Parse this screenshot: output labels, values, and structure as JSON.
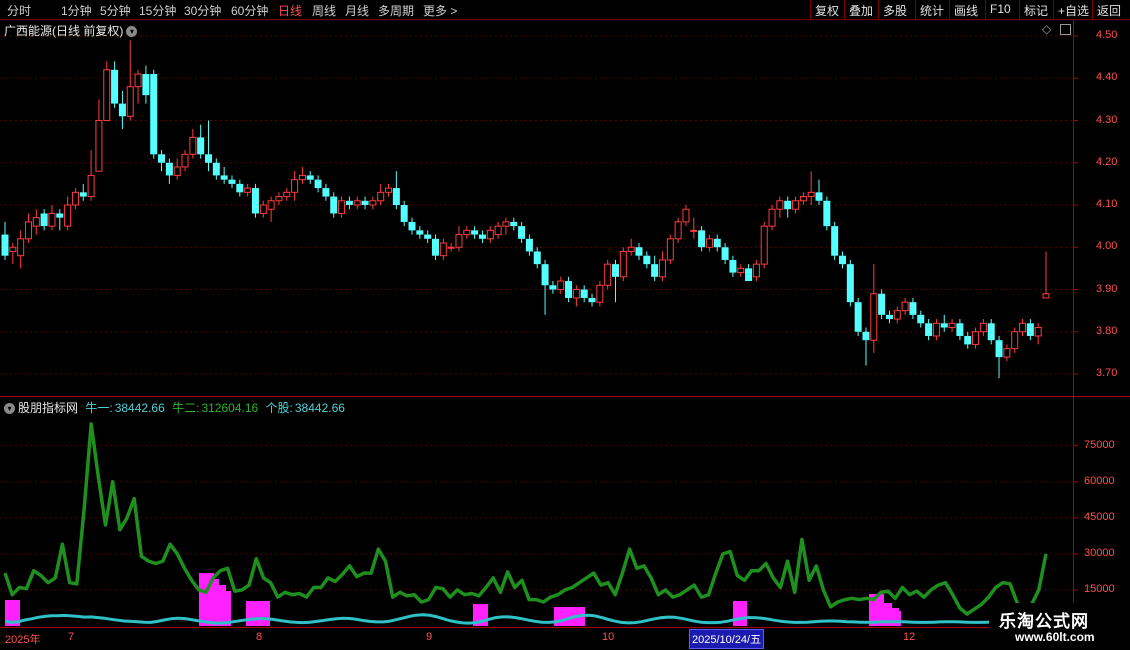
{
  "toolbar": {
    "periods": [
      "分时",
      "1分钟",
      "5分钟",
      "15分钟",
      "30分钟",
      "60分钟",
      "日线",
      "周线",
      "月线",
      "多周期",
      "更多"
    ],
    "active_period": "日线",
    "more_arrow": ">",
    "buttons": [
      "复权",
      "叠加",
      "多股",
      "统计",
      "画线",
      "F10",
      "标记",
      "+自选",
      "返回"
    ]
  },
  "main_panel": {
    "title": "广西能源(日线 前复权)",
    "price_ticks": [
      "4.50",
      "4.40",
      "4.30",
      "4.20",
      "4.10",
      "4.00",
      "3.90",
      "3.80",
      "3.70"
    ],
    "price_range": [
      3.665,
      4.535
    ]
  },
  "indicator_panel": {
    "name": "股朋指标网",
    "legend": [
      {
        "label": "牛一:",
        "value": "38442.66",
        "color": "#4fd2d9"
      },
      {
        "label": "牛二:",
        "value": "312604.16",
        "color": "#2fb52f"
      },
      {
        "label": "个股:",
        "value": "38442.66",
        "color": "#4fd2d9"
      }
    ],
    "ticks": [
      "75000",
      "60000",
      "45000",
      "30000",
      "15000"
    ],
    "range": [
      0,
      89000
    ]
  },
  "date_axis": {
    "labels": [
      "2025年",
      "7",
      "8",
      "9",
      "10",
      "12"
    ],
    "selected_date": "2025/10/24/五"
  },
  "colors": {
    "up": "#ff3c3c",
    "down": "#54ffff",
    "green_line": "#1f8f1f",
    "cyan_line": "#2fc0c8",
    "magenta": "#ff22ff",
    "grid": "#5a0000",
    "axis": "#ff5050"
  },
  "chart_data": {
    "type": "candlestick",
    "candles": [
      [
        4.03,
        3.98,
        4.06,
        3.97
      ],
      [
        3.99,
        4.0,
        4.01,
        3.96
      ],
      [
        3.98,
        4.02,
        4.04,
        3.95
      ],
      [
        4.02,
        4.06,
        4.08,
        4.01
      ],
      [
        4.05,
        4.07,
        4.09,
        4.03
      ],
      [
        4.08,
        4.05,
        4.09,
        4.04
      ],
      [
        4.05,
        4.08,
        4.1,
        4.04
      ],
      [
        4.08,
        4.07,
        4.09,
        4.04
      ],
      [
        4.05,
        4.1,
        4.12,
        4.04
      ],
      [
        4.1,
        4.13,
        4.14,
        4.09
      ],
      [
        4.13,
        4.12,
        4.15,
        4.11
      ],
      [
        4.12,
        4.17,
        4.23,
        4.11
      ],
      [
        4.18,
        4.3,
        4.35,
        4.29
      ],
      [
        4.3,
        4.42,
        4.44,
        4.3
      ],
      [
        4.42,
        4.34,
        4.44,
        4.33
      ],
      [
        4.34,
        4.31,
        4.37,
        4.28
      ],
      [
        4.31,
        4.38,
        4.49,
        4.3
      ],
      [
        4.38,
        4.41,
        4.42,
        4.34
      ],
      [
        4.41,
        4.36,
        4.43,
        4.34
      ],
      [
        4.41,
        4.22,
        4.42,
        4.21
      ],
      [
        4.22,
        4.2,
        4.23,
        4.18
      ],
      [
        4.2,
        4.17,
        4.21,
        4.15
      ],
      [
        4.17,
        4.19,
        4.21,
        4.16
      ],
      [
        4.19,
        4.22,
        4.23,
        4.18
      ],
      [
        4.22,
        4.26,
        4.28,
        4.21
      ],
      [
        4.26,
        4.22,
        4.29,
        4.21
      ],
      [
        4.22,
        4.2,
        4.3,
        4.18
      ],
      [
        4.2,
        4.17,
        4.21,
        4.16
      ],
      [
        4.17,
        4.16,
        4.19,
        4.15
      ],
      [
        4.16,
        4.15,
        4.17,
        4.14
      ],
      [
        4.15,
        4.13,
        4.16,
        4.12
      ],
      [
        4.13,
        4.14,
        4.15,
        4.12
      ],
      [
        4.14,
        4.08,
        4.15,
        4.07
      ],
      [
        4.08,
        4.1,
        4.11,
        4.07
      ],
      [
        4.09,
        4.11,
        4.12,
        4.06
      ],
      [
        4.11,
        4.12,
        4.13,
        4.1
      ],
      [
        4.12,
        4.13,
        4.14,
        4.11
      ],
      [
        4.13,
        4.16,
        4.18,
        4.11
      ],
      [
        4.16,
        4.17,
        4.19,
        4.15
      ],
      [
        4.17,
        4.16,
        4.18,
        4.15
      ],
      [
        4.16,
        4.14,
        4.17,
        4.13
      ],
      [
        4.14,
        4.12,
        4.15,
        4.11
      ],
      [
        4.12,
        4.08,
        4.13,
        4.07
      ],
      [
        4.08,
        4.11,
        4.12,
        4.07
      ],
      [
        4.11,
        4.1,
        4.12,
        4.09
      ],
      [
        4.1,
        4.11,
        4.12,
        4.09
      ],
      [
        4.11,
        4.1,
        4.12,
        4.09
      ],
      [
        4.1,
        4.11,
        4.12,
        4.09
      ],
      [
        4.11,
        4.13,
        4.15,
        4.1
      ],
      [
        4.13,
        4.14,
        4.15,
        4.12
      ],
      [
        4.14,
        4.1,
        4.18,
        4.09
      ],
      [
        4.1,
        4.06,
        4.11,
        4.05
      ],
      [
        4.06,
        4.04,
        4.07,
        4.03
      ],
      [
        4.04,
        4.03,
        4.05,
        4.02
      ],
      [
        4.03,
        4.02,
        4.04,
        4.01
      ],
      [
        4.02,
        3.98,
        4.03,
        3.97
      ],
      [
        3.98,
        4.01,
        4.02,
        3.97
      ],
      [
        4.0,
        4.0,
        4.01,
        3.99
      ],
      [
        4.0,
        4.03,
        4.05,
        3.99
      ],
      [
        4.03,
        4.04,
        4.05,
        4.02
      ],
      [
        4.04,
        4.03,
        4.05,
        4.02
      ],
      [
        4.03,
        4.02,
        4.04,
        4.01
      ],
      [
        4.02,
        4.04,
        4.05,
        4.01
      ],
      [
        4.03,
        4.05,
        4.06,
        4.02
      ],
      [
        4.05,
        4.06,
        4.07,
        4.03
      ],
      [
        4.06,
        4.05,
        4.07,
        4.04
      ],
      [
        4.05,
        4.02,
        4.06,
        4.01
      ],
      [
        4.02,
        3.99,
        4.03,
        3.98
      ],
      [
        3.99,
        3.96,
        4.0,
        3.95
      ],
      [
        3.96,
        3.91,
        3.97,
        3.84
      ],
      [
        3.91,
        3.9,
        3.92,
        3.89
      ],
      [
        3.9,
        3.92,
        3.93,
        3.89
      ],
      [
        3.92,
        3.88,
        3.93,
        3.87
      ],
      [
        3.88,
        3.9,
        3.91,
        3.86
      ],
      [
        3.9,
        3.88,
        3.91,
        3.87
      ],
      [
        3.88,
        3.87,
        3.89,
        3.86
      ],
      [
        3.87,
        3.91,
        3.92,
        3.86
      ],
      [
        3.91,
        3.96,
        3.97,
        3.9
      ],
      [
        3.96,
        3.93,
        3.97,
        3.87
      ],
      [
        3.93,
        3.99,
        4.0,
        3.92
      ],
      [
        3.99,
        4.0,
        4.02,
        3.98
      ],
      [
        4.0,
        3.98,
        4.01,
        3.97
      ],
      [
        3.98,
        3.96,
        3.99,
        3.95
      ],
      [
        3.96,
        3.93,
        3.98,
        3.92
      ],
      [
        3.93,
        3.97,
        3.99,
        3.92
      ],
      [
        3.97,
        4.02,
        4.03,
        3.96
      ],
      [
        4.02,
        4.06,
        4.07,
        4.01
      ],
      [
        4.06,
        4.09,
        4.1,
        4.05
      ],
      [
        4.04,
        4.04,
        4.07,
        4.02
      ],
      [
        4.04,
        4.0,
        4.05,
        3.99
      ],
      [
        4.0,
        4.02,
        4.03,
        3.99
      ],
      [
        4.02,
        4.0,
        4.03,
        3.99
      ],
      [
        4.0,
        3.97,
        4.01,
        3.96
      ],
      [
        3.97,
        3.94,
        3.98,
        3.93
      ],
      [
        3.94,
        3.95,
        3.96,
        3.93
      ],
      [
        3.95,
        3.92,
        3.96,
        3.93
      ],
      [
        3.93,
        3.96,
        3.97,
        3.92
      ],
      [
        3.96,
        4.05,
        4.06,
        3.95
      ],
      [
        4.05,
        4.09,
        4.1,
        4.04
      ],
      [
        4.09,
        4.11,
        4.12,
        4.07
      ],
      [
        4.11,
        4.09,
        4.12,
        4.07
      ],
      [
        4.09,
        4.11,
        4.12,
        4.08
      ],
      [
        4.11,
        4.12,
        4.13,
        4.1
      ],
      [
        4.12,
        4.13,
        4.18,
        4.1
      ],
      [
        4.13,
        4.11,
        4.16,
        4.1
      ],
      [
        4.11,
        4.05,
        4.12,
        4.04
      ],
      [
        4.05,
        3.98,
        4.06,
        3.97
      ],
      [
        3.98,
        3.96,
        3.99,
        3.95
      ],
      [
        3.96,
        3.87,
        3.97,
        3.86
      ],
      [
        3.87,
        3.8,
        3.88,
        3.79
      ],
      [
        3.8,
        3.78,
        3.81,
        3.72
      ],
      [
        3.78,
        3.89,
        3.96,
        3.75
      ],
      [
        3.89,
        3.84,
        3.9,
        3.83
      ],
      [
        3.84,
        3.83,
        3.85,
        3.82
      ],
      [
        3.83,
        3.85,
        3.86,
        3.82
      ],
      [
        3.85,
        3.87,
        3.88,
        3.84
      ],
      [
        3.87,
        3.84,
        3.88,
        3.83
      ],
      [
        3.84,
        3.82,
        3.85,
        3.81
      ],
      [
        3.82,
        3.79,
        3.83,
        3.78
      ],
      [
        3.79,
        3.82,
        3.83,
        3.78
      ],
      [
        3.82,
        3.81,
        3.84,
        3.8
      ],
      [
        3.81,
        3.82,
        3.83,
        3.8
      ],
      [
        3.82,
        3.79,
        3.83,
        3.78
      ],
      [
        3.79,
        3.77,
        3.8,
        3.76
      ],
      [
        3.77,
        3.8,
        3.81,
        3.76
      ],
      [
        3.8,
        3.82,
        3.83,
        3.79
      ],
      [
        3.82,
        3.78,
        3.83,
        3.77
      ],
      [
        3.78,
        3.74,
        3.79,
        3.69
      ],
      [
        3.74,
        3.76,
        3.77,
        3.73
      ],
      [
        3.76,
        3.8,
        3.81,
        3.75
      ],
      [
        3.8,
        3.82,
        3.83,
        3.79
      ],
      [
        3.82,
        3.79,
        3.83,
        3.78
      ],
      [
        3.79,
        3.81,
        3.82,
        3.77
      ],
      [
        3.88,
        3.89,
        3.99,
        3.88
      ]
    ],
    "green_line": [
      22000,
      13000,
      16000,
      15500,
      23000,
      21000,
      18000,
      20000,
      34000,
      18000,
      17500,
      48000,
      84000,
      62000,
      42000,
      60000,
      40000,
      45000,
      53000,
      29000,
      27000,
      26000,
      27000,
      34000,
      30000,
      24000,
      19000,
      15000,
      14000,
      20000,
      23000,
      24000,
      14500,
      15000,
      17000,
      28000,
      20000,
      18000,
      12000,
      14000,
      13000,
      13500,
      12000,
      16000,
      16000,
      20000,
      18500,
      21500,
      25000,
      20500,
      22000,
      22000,
      32000,
      27000,
      12000,
      14000,
      12500,
      13000,
      10000,
      11000,
      16000,
      15500,
      12000,
      15000,
      13000,
      13500,
      12500,
      16000,
      20000,
      14000,
      22500,
      16000,
      19000,
      11000,
      11000,
      10000,
      12000,
      13000,
      15000,
      16000,
      18000,
      20000,
      22000,
      17000,
      18000,
      13000,
      22000,
      32000,
      24000,
      25000,
      20000,
      13000,
      15000,
      12000,
      13000,
      15000,
      17000,
      12000,
      13000,
      22000,
      30000,
      31000,
      21000,
      19000,
      23000,
      23000,
      26000,
      20000,
      16000,
      27000,
      14000,
      36000,
      19000,
      25000,
      15000,
      8000,
      10000,
      11000,
      11500,
      11000,
      11500,
      11000,
      14000,
      14500,
      11500,
      16000,
      13000,
      14500,
      12000,
      15000,
      17000,
      18000,
      13000,
      7500,
      5000,
      7000,
      9000,
      12000,
      16000,
      18000,
      17500,
      9500,
      7000,
      9000,
      15000,
      30000
    ],
    "cyan_line": [
      2000,
      1500,
      1800,
      2500,
      3000,
      3600,
      4000,
      4300,
      4300,
      4400,
      4200,
      4000,
      3700,
      3800,
      3500,
      3200,
      2800,
      2400,
      2100,
      1900,
      1800,
      1600,
      1500,
      1900,
      2500,
      3000,
      3200,
      3100,
      2700,
      2200,
      1800,
      1400,
      1200,
      1300,
      1600,
      2000,
      2400,
      2800,
      3000,
      3100,
      2900,
      2500,
      2100,
      1700,
      1500,
      1400,
      1600,
      1900,
      2300,
      2700,
      3000,
      3200,
      3100,
      2800,
      2300,
      1900,
      1700,
      1700,
      2000,
      2600,
      3300,
      4000,
      4500,
      4700,
      4500,
      3900,
      3100,
      2300,
      1700,
      1300,
      1200,
      1400,
      2000,
      2800,
      3500,
      3800,
      3800,
      3500,
      3000,
      2400,
      1900,
      1600,
      1500,
      1700,
      2300,
      3100,
      3900,
      4400,
      4500,
      4200,
      3500,
      2700,
      2000,
      1500,
      1300,
      1400,
      1800,
      2400,
      3000,
      3500,
      3700,
      3600,
      3200,
      2600,
      2000,
      1600,
      1400,
      1400,
      1600,
      2000,
      2600,
      3100,
      3500,
      3500,
      3300,
      2900,
      2400,
      2000,
      1700,
      1500,
      1500,
      1600,
      1800,
      2000,
      2100,
      2100,
      2000,
      1800,
      1700,
      1600,
      1600,
      1600,
      1700,
      1800,
      1800,
      1800,
      1700,
      1600,
      1500,
      1500,
      1600,
      1700,
      1800,
      1800,
      1700,
      1600,
      1500,
      1500,
      1600,
      1700,
      1800,
      1800,
      1700,
      1600,
      1500,
      1400,
      1400,
      1500
    ]
  }
}
